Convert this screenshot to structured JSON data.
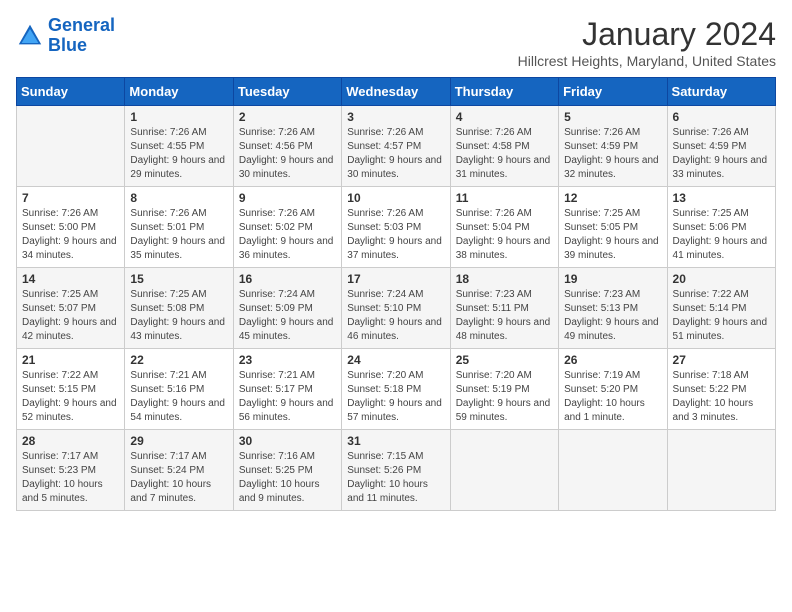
{
  "logo": {
    "line1": "General",
    "line2": "Blue"
  },
  "title": "January 2024",
  "subtitle": "Hillcrest Heights, Maryland, United States",
  "days_of_week": [
    "Sunday",
    "Monday",
    "Tuesday",
    "Wednesday",
    "Thursday",
    "Friday",
    "Saturday"
  ],
  "weeks": [
    [
      {
        "day": "",
        "sunrise": "",
        "sunset": "",
        "daylight": ""
      },
      {
        "day": "1",
        "sunrise": "Sunrise: 7:26 AM",
        "sunset": "Sunset: 4:55 PM",
        "daylight": "Daylight: 9 hours and 29 minutes."
      },
      {
        "day": "2",
        "sunrise": "Sunrise: 7:26 AM",
        "sunset": "Sunset: 4:56 PM",
        "daylight": "Daylight: 9 hours and 30 minutes."
      },
      {
        "day": "3",
        "sunrise": "Sunrise: 7:26 AM",
        "sunset": "Sunset: 4:57 PM",
        "daylight": "Daylight: 9 hours and 30 minutes."
      },
      {
        "day": "4",
        "sunrise": "Sunrise: 7:26 AM",
        "sunset": "Sunset: 4:58 PM",
        "daylight": "Daylight: 9 hours and 31 minutes."
      },
      {
        "day": "5",
        "sunrise": "Sunrise: 7:26 AM",
        "sunset": "Sunset: 4:59 PM",
        "daylight": "Daylight: 9 hours and 32 minutes."
      },
      {
        "day": "6",
        "sunrise": "Sunrise: 7:26 AM",
        "sunset": "Sunset: 4:59 PM",
        "daylight": "Daylight: 9 hours and 33 minutes."
      }
    ],
    [
      {
        "day": "7",
        "sunrise": "Sunrise: 7:26 AM",
        "sunset": "Sunset: 5:00 PM",
        "daylight": "Daylight: 9 hours and 34 minutes."
      },
      {
        "day": "8",
        "sunrise": "Sunrise: 7:26 AM",
        "sunset": "Sunset: 5:01 PM",
        "daylight": "Daylight: 9 hours and 35 minutes."
      },
      {
        "day": "9",
        "sunrise": "Sunrise: 7:26 AM",
        "sunset": "Sunset: 5:02 PM",
        "daylight": "Daylight: 9 hours and 36 minutes."
      },
      {
        "day": "10",
        "sunrise": "Sunrise: 7:26 AM",
        "sunset": "Sunset: 5:03 PM",
        "daylight": "Daylight: 9 hours and 37 minutes."
      },
      {
        "day": "11",
        "sunrise": "Sunrise: 7:26 AM",
        "sunset": "Sunset: 5:04 PM",
        "daylight": "Daylight: 9 hours and 38 minutes."
      },
      {
        "day": "12",
        "sunrise": "Sunrise: 7:25 AM",
        "sunset": "Sunset: 5:05 PM",
        "daylight": "Daylight: 9 hours and 39 minutes."
      },
      {
        "day": "13",
        "sunrise": "Sunrise: 7:25 AM",
        "sunset": "Sunset: 5:06 PM",
        "daylight": "Daylight: 9 hours and 41 minutes."
      }
    ],
    [
      {
        "day": "14",
        "sunrise": "Sunrise: 7:25 AM",
        "sunset": "Sunset: 5:07 PM",
        "daylight": "Daylight: 9 hours and 42 minutes."
      },
      {
        "day": "15",
        "sunrise": "Sunrise: 7:25 AM",
        "sunset": "Sunset: 5:08 PM",
        "daylight": "Daylight: 9 hours and 43 minutes."
      },
      {
        "day": "16",
        "sunrise": "Sunrise: 7:24 AM",
        "sunset": "Sunset: 5:09 PM",
        "daylight": "Daylight: 9 hours and 45 minutes."
      },
      {
        "day": "17",
        "sunrise": "Sunrise: 7:24 AM",
        "sunset": "Sunset: 5:10 PM",
        "daylight": "Daylight: 9 hours and 46 minutes."
      },
      {
        "day": "18",
        "sunrise": "Sunrise: 7:23 AM",
        "sunset": "Sunset: 5:11 PM",
        "daylight": "Daylight: 9 hours and 48 minutes."
      },
      {
        "day": "19",
        "sunrise": "Sunrise: 7:23 AM",
        "sunset": "Sunset: 5:13 PM",
        "daylight": "Daylight: 9 hours and 49 minutes."
      },
      {
        "day": "20",
        "sunrise": "Sunrise: 7:22 AM",
        "sunset": "Sunset: 5:14 PM",
        "daylight": "Daylight: 9 hours and 51 minutes."
      }
    ],
    [
      {
        "day": "21",
        "sunrise": "Sunrise: 7:22 AM",
        "sunset": "Sunset: 5:15 PM",
        "daylight": "Daylight: 9 hours and 52 minutes."
      },
      {
        "day": "22",
        "sunrise": "Sunrise: 7:21 AM",
        "sunset": "Sunset: 5:16 PM",
        "daylight": "Daylight: 9 hours and 54 minutes."
      },
      {
        "day": "23",
        "sunrise": "Sunrise: 7:21 AM",
        "sunset": "Sunset: 5:17 PM",
        "daylight": "Daylight: 9 hours and 56 minutes."
      },
      {
        "day": "24",
        "sunrise": "Sunrise: 7:20 AM",
        "sunset": "Sunset: 5:18 PM",
        "daylight": "Daylight: 9 hours and 57 minutes."
      },
      {
        "day": "25",
        "sunrise": "Sunrise: 7:20 AM",
        "sunset": "Sunset: 5:19 PM",
        "daylight": "Daylight: 9 hours and 59 minutes."
      },
      {
        "day": "26",
        "sunrise": "Sunrise: 7:19 AM",
        "sunset": "Sunset: 5:20 PM",
        "daylight": "Daylight: 10 hours and 1 minute."
      },
      {
        "day": "27",
        "sunrise": "Sunrise: 7:18 AM",
        "sunset": "Sunset: 5:22 PM",
        "daylight": "Daylight: 10 hours and 3 minutes."
      }
    ],
    [
      {
        "day": "28",
        "sunrise": "Sunrise: 7:17 AM",
        "sunset": "Sunset: 5:23 PM",
        "daylight": "Daylight: 10 hours and 5 minutes."
      },
      {
        "day": "29",
        "sunrise": "Sunrise: 7:17 AM",
        "sunset": "Sunset: 5:24 PM",
        "daylight": "Daylight: 10 hours and 7 minutes."
      },
      {
        "day": "30",
        "sunrise": "Sunrise: 7:16 AM",
        "sunset": "Sunset: 5:25 PM",
        "daylight": "Daylight: 10 hours and 9 minutes."
      },
      {
        "day": "31",
        "sunrise": "Sunrise: 7:15 AM",
        "sunset": "Sunset: 5:26 PM",
        "daylight": "Daylight: 10 hours and 11 minutes."
      },
      {
        "day": "",
        "sunrise": "",
        "sunset": "",
        "daylight": ""
      },
      {
        "day": "",
        "sunrise": "",
        "sunset": "",
        "daylight": ""
      },
      {
        "day": "",
        "sunrise": "",
        "sunset": "",
        "daylight": ""
      }
    ]
  ]
}
